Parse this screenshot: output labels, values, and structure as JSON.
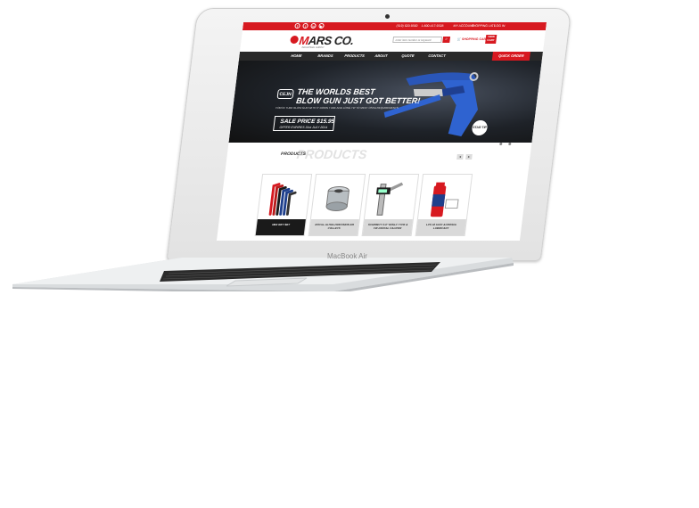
{
  "device": {
    "label": "MacBook Air"
  },
  "site": {
    "logo": {
      "prefix": "M",
      "name": "ARS CO.",
      "tagline": "INDUSTRIAL SUPPLY"
    },
    "topbar": {
      "social_icons": [
        "facebook-icon",
        "twitter-icon",
        "linkedin-icon",
        "youtube-icon"
      ],
      "phone_local": "(519) 620-9300",
      "phone_toll": "1-800-417-9328",
      "my_account": "MY ACCOUNT",
      "shopping_list": "SHOPPING LIST",
      "login": "LOG IN"
    },
    "search": {
      "placeholder": "enter item number or keyword"
    },
    "cart": {
      "label": "SHOPPING CART",
      "view_label": "VIEW CART"
    },
    "nav": {
      "items": [
        "HOME",
        "BRANDS",
        "PRODUCTS",
        "ABOUT",
        "QUOTE",
        "CONTACT"
      ],
      "quick_order": "QUICK ORDER"
    },
    "hero": {
      "brand_badge": "CEJN",
      "title_line1": "THE WORLDS BEST",
      "title_line2": "BLOW GUN JUST GOT BETTER!",
      "subtitle": "FORCE TUBE BLOW GUN WITH 6\" DOWN TUBE AND LONG TIP TO MEET OSHA REQUIREMENTS",
      "price": "SALE PRICE $15.95",
      "offer": "OFFER EXPIRES 31st JULY 2014",
      "badge": "STAR TIP",
      "slides": 3,
      "active_slide": 2
    },
    "products": {
      "title": "PRODUCTS",
      "watermark": "PRODUCTS",
      "prev": "◂",
      "next": "▸",
      "items": [
        {
          "label": "HEX KEY SET"
        },
        {
          "label": "ROYAL ULTRA-PRECISION ER COLLETS"
        },
        {
          "label": "STARRETT 0-6\" W/SLC TYPE & FW DIGITAL CALIPER"
        },
        {
          "label": "LPS #2 FAST ACROSOL LUBRICANT"
        }
      ]
    }
  },
  "colors": {
    "brand_red": "#d71920",
    "nav_dark": "#2a2a2a",
    "hero_dark": "#1e2228"
  }
}
